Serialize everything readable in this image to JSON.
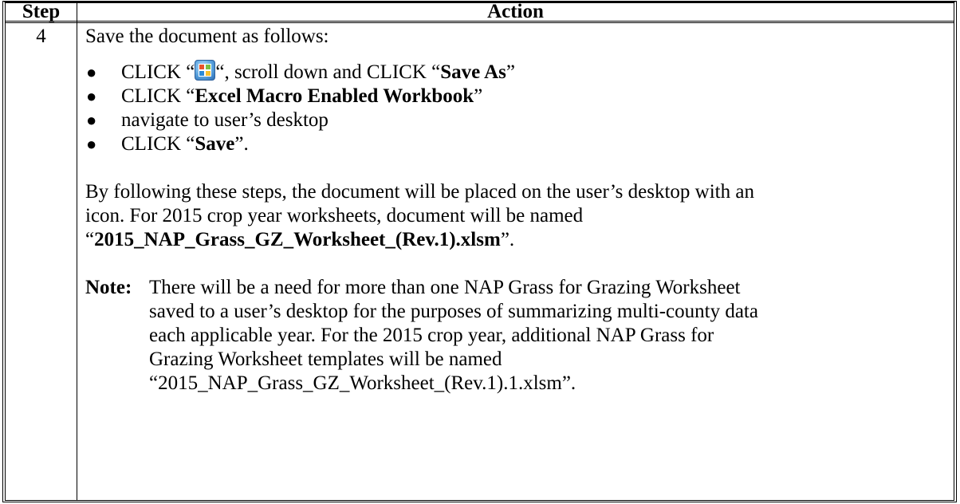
{
  "table": {
    "header": {
      "step": "Step",
      "action": "Action"
    },
    "row": {
      "step": "4",
      "intro": "Save the document as follows:",
      "bullets": [
        {
          "pre": "CLICK “",
          "icon": "office-button-icon",
          "mid": "“, scroll down and CLICK “",
          "bold": "Save As",
          "post": "”"
        },
        {
          "pre": "CLICK “",
          "bold": "Excel Macro Enabled Workbook",
          "post": "”"
        },
        {
          "text": "navigate to user’s desktop"
        },
        {
          "pre": "CLICK “",
          "bold": "Save",
          "post": "”."
        }
      ],
      "paragraph": {
        "line1": "By following these steps, the document will be placed on the user’s desktop with an",
        "line2": "icon.  For 2015 crop year worksheets, document will be named",
        "line3_pre": "“",
        "line3_bold": "2015_NAP_Grass_GZ_Worksheet_(Rev.1).xlsm",
        "line3_post": "”."
      },
      "note": {
        "label": "Note:",
        "lines": [
          "There will be a need for more than one NAP Grass for Grazing Worksheet",
          "saved to a user’s desktop for the purposes of summarizing multi-county data",
          "each applicable year.  For the 2015 crop year, additional NAP Grass for",
          "Grazing Worksheet templates will be named",
          "“2015_NAP_Grass_GZ_Worksheet_(Rev.1).1.xlsm”."
        ]
      }
    }
  }
}
